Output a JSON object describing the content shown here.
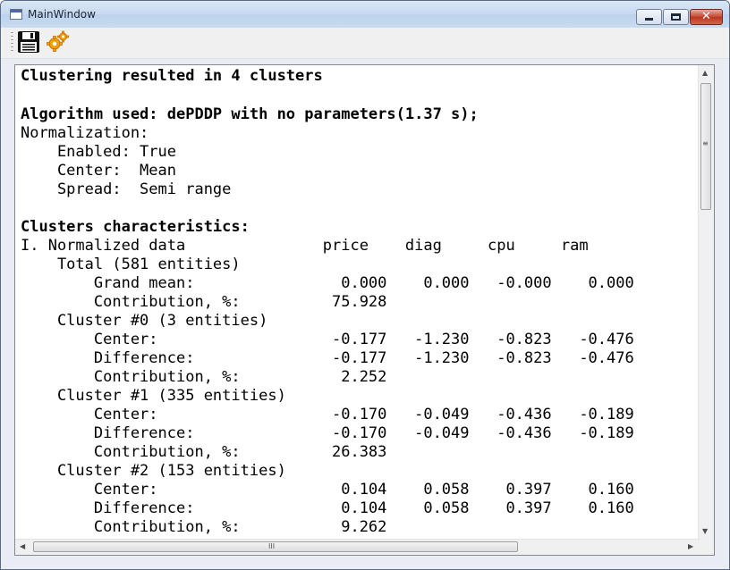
{
  "window": {
    "title": "MainWindow",
    "minimize_label": "",
    "maximize_label": "",
    "close_label": "✕"
  },
  "toolbar": {
    "icons": [
      "save-icon",
      "settings-gear-icon"
    ]
  },
  "report": {
    "clusters_line": "Clustering resulted in 4 clusters",
    "algorithm_line": "Algorithm used: dePDDP with no parameters(1.37 s);",
    "normalization_title": "Normalization:",
    "enabled": "    Enabled: True",
    "center": "    Center:  Mean",
    "spread": "    Spread:  Semi range",
    "characteristics_title": "Clusters characteristics:",
    "header": "I. Normalized data               price    diag     cpu     ram",
    "total": "    Total (581 entities)",
    "grand_mean": "        Grand mean:                0.000    0.000   -0.000    0.000",
    "total_contribution": "        Contribution, %:          75.928",
    "c0_title": "    Cluster #0 (3 entities)",
    "c0_center": "        Center:                   -0.177   -1.230   -0.823   -0.476",
    "c0_difference": "        Difference:               -0.177   -1.230   -0.823   -0.476",
    "c0_contribution": "        Contribution, %:           2.252",
    "c1_title": "    Cluster #1 (335 entities)",
    "c1_center": "        Center:                   -0.170   -0.049   -0.436   -0.189",
    "c1_difference": "        Difference:               -0.170   -0.049   -0.436   -0.189",
    "c1_contribution": "        Contribution, %:          26.383",
    "c2_title": "    Cluster #2 (153 entities)",
    "c2_center": "        Center:                    0.104    0.058    0.397    0.160",
    "c2_difference": "        Difference:                0.104    0.058    0.397    0.160",
    "c2_contribution": "        Contribution, %:           9.262"
  },
  "scrollbars": {
    "vertical_grip": "≡",
    "horizontal_grip": "III"
  }
}
